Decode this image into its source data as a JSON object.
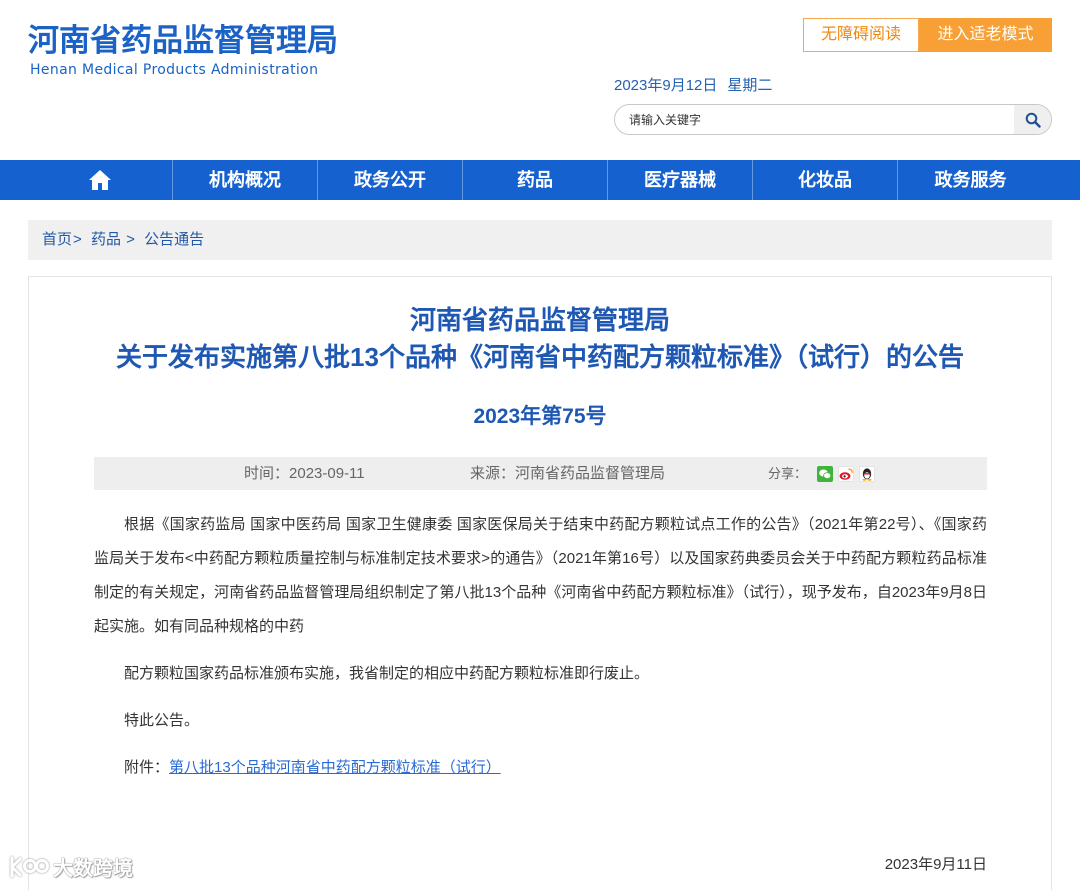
{
  "header": {
    "logo_cn": "河南省药品监督管理局",
    "logo_en": "Henan Medical Products Administration",
    "accessibility_label": "无障碍阅读",
    "elderly_mode_label": "进入适老模式",
    "date": "2023年9月12日",
    "weekday": "星期二",
    "search": {
      "placeholder": "请输入关键字",
      "value": "",
      "icon": "search-icon"
    }
  },
  "nav": {
    "home_icon": "home-icon",
    "items": [
      {
        "label": "机构概况"
      },
      {
        "label": "政务公开"
      },
      {
        "label": "药品"
      },
      {
        "label": "医疗器械"
      },
      {
        "label": "化妆品"
      },
      {
        "label": "政务服务"
      }
    ]
  },
  "breadcrumb": {
    "items": [
      "首页",
      "药品",
      "公告通告"
    ],
    "separator": ">"
  },
  "article": {
    "title_line1": "河南省药品监督管理局",
    "title_line2": "关于发布实施第八批13个品种《河南省中药配方颗粒标准》（试行）的公告",
    "doc_number": "2023年第75号",
    "meta": {
      "time_label": "时间：",
      "time": "2023-09-11",
      "source_label": "来源：",
      "source": "河南省药品监督管理局",
      "share_label": "分享："
    },
    "share_icons": [
      "wechat-icon",
      "weibo-icon",
      "qq-icon"
    ],
    "paragraphs": [
      "根据《国家药监局 国家中医药局 国家卫生健康委 国家医保局关于结束中药配方颗粒试点工作的公告》（2021年第22号）、《国家药监局关于发布<中药配方颗粒质量控制与标准制定技术要求>的通告》（2021年第16号）以及国家药典委员会关于中药配方颗粒药品标准制定的有关规定，河南省药品监督管理局组织制定了第八批13个品种《河南省中药配方颗粒标准》（试行），现予发布，自2023年9月8日起实施。如有同品种规格的中药",
      "配方颗粒国家药品标准颁布实施，我省制定的相应中药配方颗粒标准即行废止。",
      "特此公告。"
    ],
    "attachment_label": "附件：",
    "attachment_link": "第八批13个品种河南省中药配方颗粒标准（试行）",
    "signature_date": "2023年9月11日"
  },
  "watermark": "大数跨境",
  "colors": {
    "brand": "#1b62c6",
    "nav": "#1561cf",
    "orange": "#f8a035",
    "title": "#1f58b3",
    "link": "#2a6bd3"
  }
}
